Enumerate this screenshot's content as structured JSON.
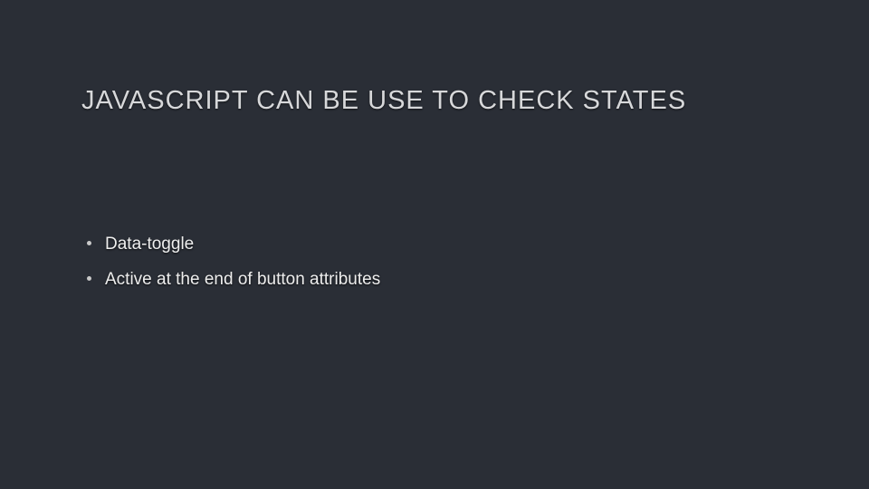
{
  "slide": {
    "title": "JAVASCRIPT CAN BE USE TO CHECK STATES",
    "bullets": [
      "Data-toggle",
      "Active  at the end of button attributes"
    ]
  }
}
